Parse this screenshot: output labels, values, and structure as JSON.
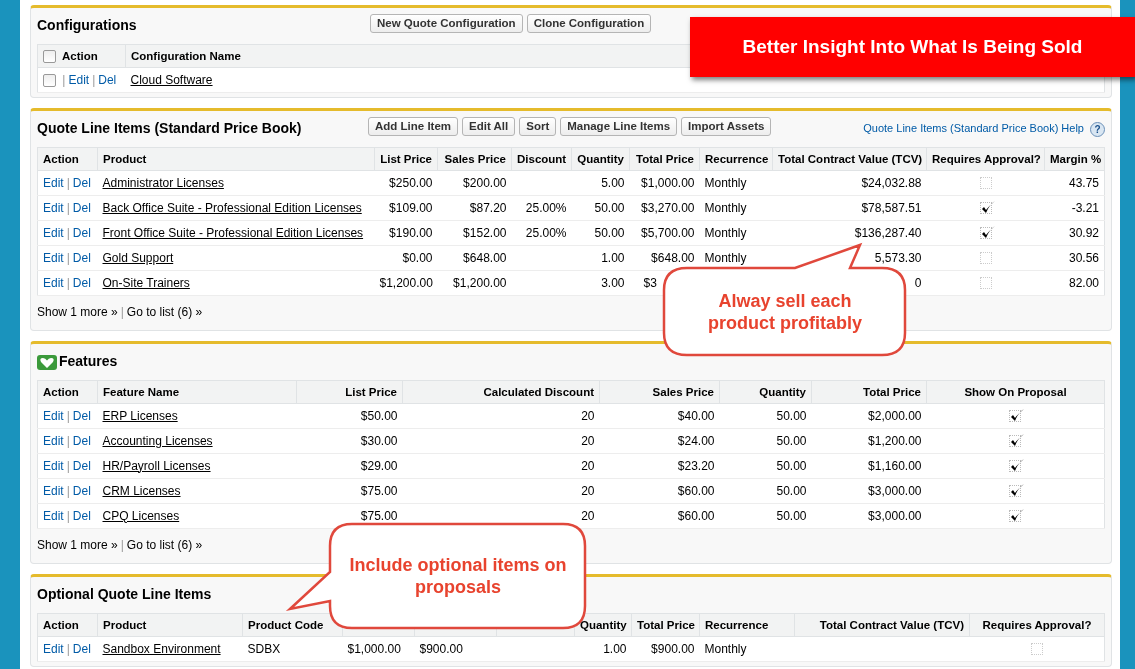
{
  "configurations": {
    "title": "Configurations",
    "buttons": [
      "New Quote Configuration",
      "Clone Configuration"
    ],
    "header_checkbox": {
      "checked": false
    },
    "action_column": "Action",
    "columns": [
      {
        "label": "Configuration Name",
        "kind": "link"
      }
    ],
    "rows": [
      {
        "checked": false,
        "actions": [
          {
            "kind": "sep",
            "text": "|"
          },
          {
            "kind": "link",
            "text": "Edit"
          },
          {
            "kind": "sep",
            "text": "|"
          },
          {
            "kind": "link",
            "text": "Del"
          }
        ],
        "cells": [
          "Cloud Software"
        ]
      }
    ]
  },
  "quote_line_items": {
    "title": "Quote Line Items (Standard Price Book)",
    "buttons": [
      "Add Line Item",
      "Edit All",
      "Sort",
      "Manage Line Items",
      "Import Assets"
    ],
    "help_link": "Quote Line Items (Standard Price Book) Help",
    "help_icon": "?",
    "action_column": "Action",
    "columns": [
      {
        "label": "Product",
        "kind": "link"
      },
      {
        "label": "List Price",
        "kind": "number"
      },
      {
        "label": "Sales Price",
        "kind": "number"
      },
      {
        "label": "Discount",
        "kind": "number"
      },
      {
        "label": "Quantity",
        "kind": "number"
      },
      {
        "label": "Total Price",
        "kind": "number"
      },
      {
        "label": "Recurrence",
        "kind": "text"
      },
      {
        "label": "Total Contract Value (TCV)",
        "kind": "number"
      },
      {
        "label": "Requires Approval?",
        "kind": "check"
      },
      {
        "label": "Margin %",
        "kind": "number"
      }
    ],
    "rows": [
      {
        "actions": [
          {
            "kind": "link",
            "text": "Edit"
          },
          {
            "kind": "sep",
            "text": "|"
          },
          {
            "kind": "link",
            "text": "Del"
          }
        ],
        "cells": [
          "Administrator Licenses",
          "$250.00",
          "$200.00",
          null,
          "5.00",
          "$1,000.00",
          "Monthly",
          "$24,032.88",
          {
            "checked": false
          },
          "43.75"
        ]
      },
      {
        "actions": [
          {
            "kind": "link",
            "text": "Edit"
          },
          {
            "kind": "sep",
            "text": "|"
          },
          {
            "kind": "link",
            "text": "Del"
          }
        ],
        "cells": [
          "Back Office Suite - Professional Edition Licenses",
          "$109.00",
          "$87.20",
          "25.00%",
          "50.00",
          "$3,270.00",
          "Monthly",
          "$78,587.51",
          {
            "checked": true
          },
          "-3.21"
        ]
      },
      {
        "actions": [
          {
            "kind": "link",
            "text": "Edit"
          },
          {
            "kind": "sep",
            "text": "|"
          },
          {
            "kind": "link",
            "text": "Del"
          }
        ],
        "cells": [
          "Front Office Suite - Professional Edition Licenses",
          "$190.00",
          "$152.00",
          "25.00%",
          "50.00",
          "$5,700.00",
          "Monthly",
          "$136,287.40",
          {
            "checked": true
          },
          "30.92"
        ]
      },
      {
        "actions": [
          {
            "kind": "link",
            "text": "Edit"
          },
          {
            "kind": "sep",
            "text": "|"
          },
          {
            "kind": "link",
            "text": "Del"
          }
        ],
        "cells": [
          "Gold Support",
          "$0.00",
          "$648.00",
          null,
          "1.00",
          "$648.00",
          "Monthly",
          "5,573.30",
          {
            "checked": false
          },
          "30.56"
        ]
      },
      {
        "actions": [
          {
            "kind": "link",
            "text": "Edit"
          },
          {
            "kind": "sep",
            "text": "|"
          },
          {
            "kind": "link",
            "text": "Del"
          }
        ],
        "cells": [
          "On-Site Trainers",
          "$1,200.00",
          "$1,200.00",
          null,
          "3.00",
          {
            "text": "$3",
            "kind": "partial"
          },
          null,
          "0",
          {
            "checked": false
          },
          "82.00"
        ]
      }
    ],
    "footer": [
      {
        "kind": "link",
        "text": "Show 1 more »"
      },
      {
        "kind": "sep",
        "text": "|"
      },
      {
        "kind": "link",
        "text": "Go to list (6) »"
      }
    ]
  },
  "features": {
    "title": "Features",
    "action_column": "Action",
    "columns": [
      {
        "label": "Feature Name",
        "kind": "link"
      },
      {
        "label": "List Price",
        "kind": "number"
      },
      {
        "label": "Calculated Discount",
        "kind": "number"
      },
      {
        "label": "Sales Price",
        "kind": "number"
      },
      {
        "label": "Quantity",
        "kind": "number"
      },
      {
        "label": "Total Price",
        "kind": "number"
      },
      {
        "label": "Show On Proposal",
        "kind": "check"
      }
    ],
    "rows": [
      {
        "actions": [
          {
            "kind": "link",
            "text": "Edit"
          },
          {
            "kind": "sep",
            "text": "|"
          },
          {
            "kind": "link",
            "text": "Del"
          }
        ],
        "cells": [
          "ERP Licenses",
          "$50.00",
          "20",
          "$40.00",
          "50.00",
          "$2,000.00",
          {
            "checked": true
          }
        ]
      },
      {
        "actions": [
          {
            "kind": "link",
            "text": "Edit"
          },
          {
            "kind": "sep",
            "text": "|"
          },
          {
            "kind": "link",
            "text": "Del"
          }
        ],
        "cells": [
          "Accounting Licenses",
          "$30.00",
          "20",
          "$24.00",
          "50.00",
          "$1,200.00",
          {
            "checked": true
          }
        ]
      },
      {
        "actions": [
          {
            "kind": "link",
            "text": "Edit"
          },
          {
            "kind": "sep",
            "text": "|"
          },
          {
            "kind": "link",
            "text": "Del"
          }
        ],
        "cells": [
          "HR/Payroll Licenses",
          "$29.00",
          "20",
          "$23.20",
          "50.00",
          "$1,160.00",
          {
            "checked": true
          }
        ]
      },
      {
        "actions": [
          {
            "kind": "link",
            "text": "Edit"
          },
          {
            "kind": "sep",
            "text": "|"
          },
          {
            "kind": "link",
            "text": "Del"
          }
        ],
        "cells": [
          "CRM Licenses",
          "$75.00",
          "20",
          "$60.00",
          "50.00",
          "$3,000.00",
          {
            "checked": true
          }
        ]
      },
      {
        "actions": [
          {
            "kind": "link",
            "text": "Edit"
          },
          {
            "kind": "sep",
            "text": "|"
          },
          {
            "kind": "link",
            "text": "Del"
          }
        ],
        "cells": [
          "CPQ Licenses",
          "$75.00",
          "20",
          "$60.00",
          "50.00",
          "$3,000.00",
          {
            "checked": true
          }
        ]
      }
    ],
    "footer": [
      {
        "kind": "link",
        "text": "Show 1 more »"
      },
      {
        "kind": "sep",
        "text": "|"
      },
      {
        "kind": "link",
        "text": "Go to list (6) »"
      }
    ]
  },
  "optional_quote_line_items": {
    "title": "Optional Quote Line Items",
    "action_column": "Action",
    "columns": [
      {
        "label": "Product",
        "kind": "link"
      },
      {
        "label": "Product Code",
        "kind": "text"
      },
      {
        "kind": "text"
      },
      {
        "kind": "text"
      },
      {
        "kind": "number"
      },
      {
        "label": "Quantity",
        "kind": "number"
      },
      {
        "label": "Total Price",
        "kind": "number"
      },
      {
        "label": "Recurrence",
        "kind": "text"
      },
      {
        "label": "Total Contract Value (TCV)",
        "kind": "number"
      },
      {
        "label": "Requires Approval?",
        "kind": "check"
      }
    ],
    "rows": [
      {
        "actions": [
          {
            "kind": "link",
            "text": "Edit"
          },
          {
            "kind": "sep",
            "text": "|"
          },
          {
            "kind": "link",
            "text": "Del"
          }
        ],
        "cells": [
          "Sandbox Environment",
          "SDBX",
          "$1,000.00",
          "$900.00",
          null,
          "1.00",
          "$900.00",
          "Monthly",
          null,
          {
            "checked": false
          }
        ]
      }
    ]
  },
  "banner": {
    "text": "Better Insight Into What Is Being Sold"
  },
  "callouts": [
    {
      "text": "Alway sell each product profitably"
    },
    {
      "text": "Include optional items on proposals"
    }
  ]
}
